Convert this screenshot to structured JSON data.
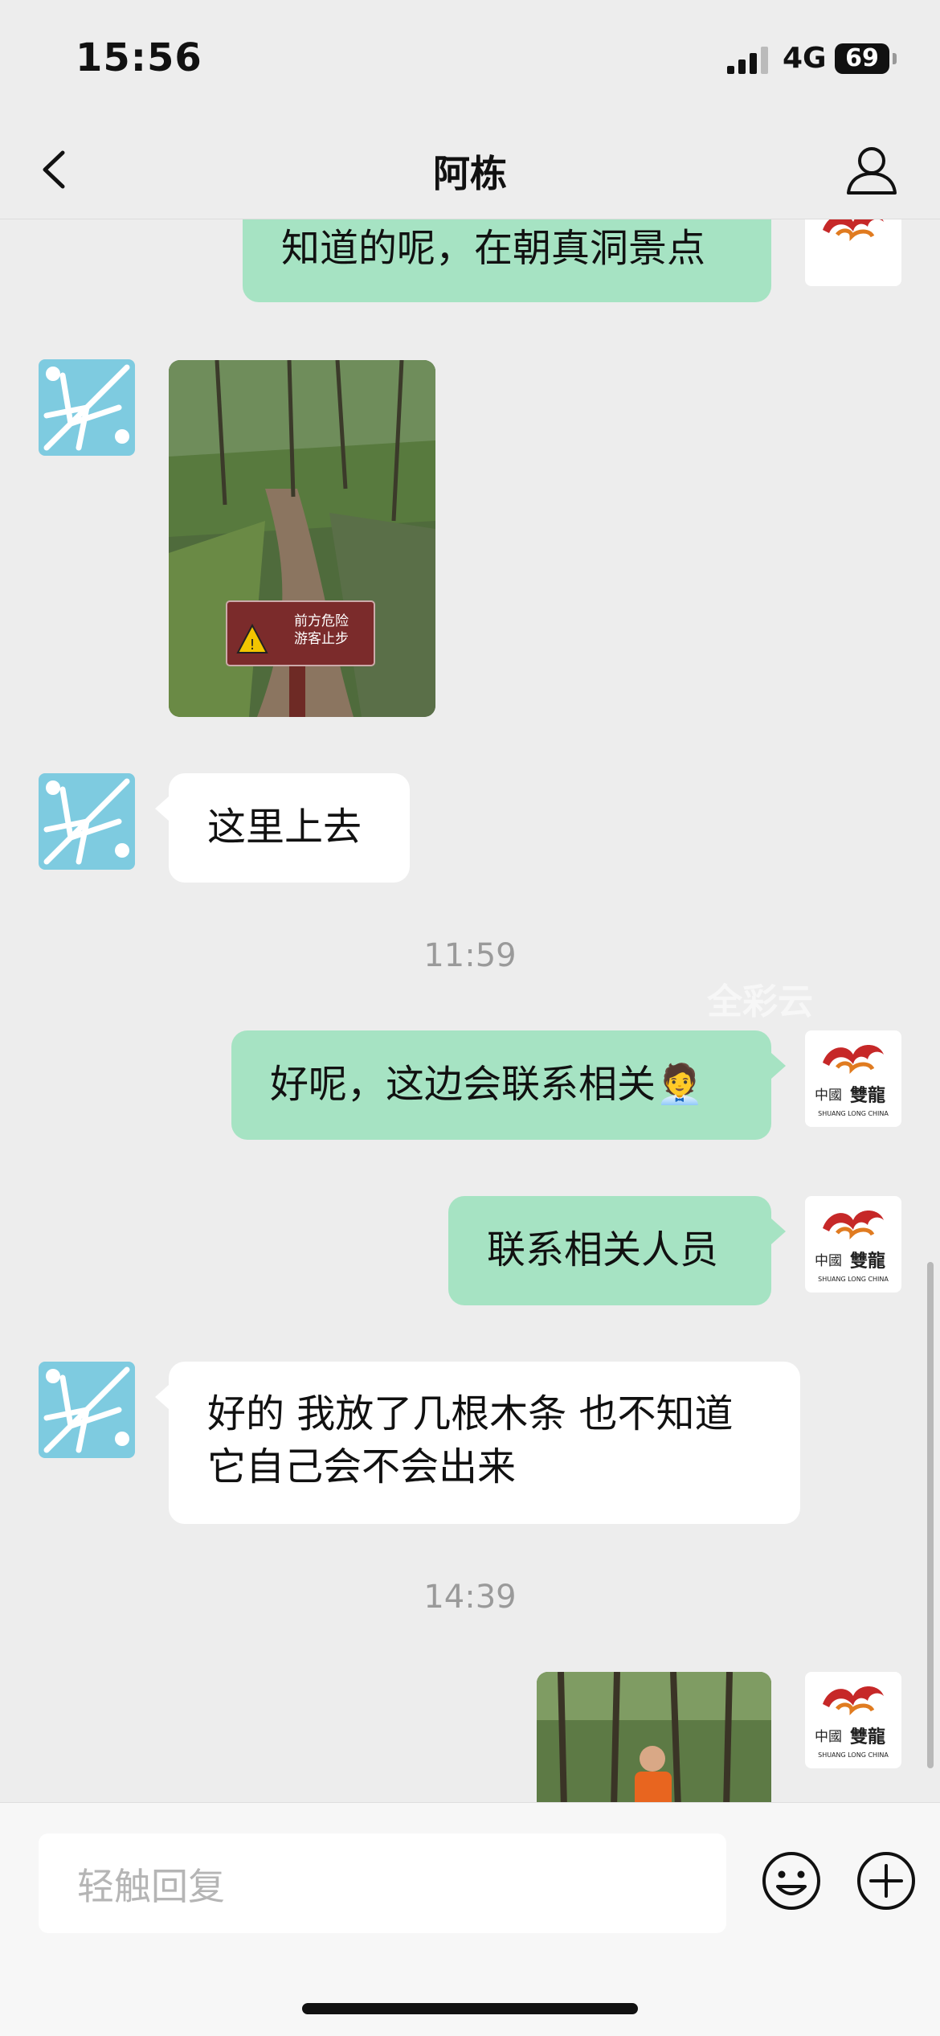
{
  "status_bar": {
    "time": "15:56",
    "network": "4G",
    "battery": "69"
  },
  "header": {
    "title": "阿栋"
  },
  "messages": [
    {
      "side": "right",
      "type": "text",
      "text": "知道的呢，在朝真洞景点"
    },
    {
      "side": "left",
      "type": "image",
      "image_sign_text": [
        "前方危险",
        "游客止步"
      ]
    },
    {
      "side": "left",
      "type": "text",
      "text": "这里上去"
    },
    {
      "type": "timestamp",
      "text": "11:59"
    },
    {
      "side": "right",
      "type": "text",
      "text": "好呢，这边会联系相关",
      "emoji": "🧑‍💼"
    },
    {
      "side": "right",
      "type": "text",
      "text": "联系相关人员"
    },
    {
      "side": "left",
      "type": "text",
      "text": "好的 我放了几根木条 也不知道它自己会不会出来"
    },
    {
      "type": "timestamp",
      "text": "14:39"
    },
    {
      "side": "right",
      "type": "image"
    }
  ],
  "avatar_me_logo": {
    "cn": "中國",
    "brand": "雙龍",
    "en": "SHUANG LONG CHINA"
  },
  "watermark": "全彩云",
  "input": {
    "placeholder": "轻触回复"
  },
  "colors": {
    "bubble_me": "#a6e3c3",
    "bubble_friend": "#ffffff",
    "background": "#ededed",
    "avatar_friend": "#7ecbe0"
  },
  "icons": [
    "back-icon",
    "profile-icon",
    "emoji-icon",
    "plus-icon",
    "signal-icon"
  ]
}
